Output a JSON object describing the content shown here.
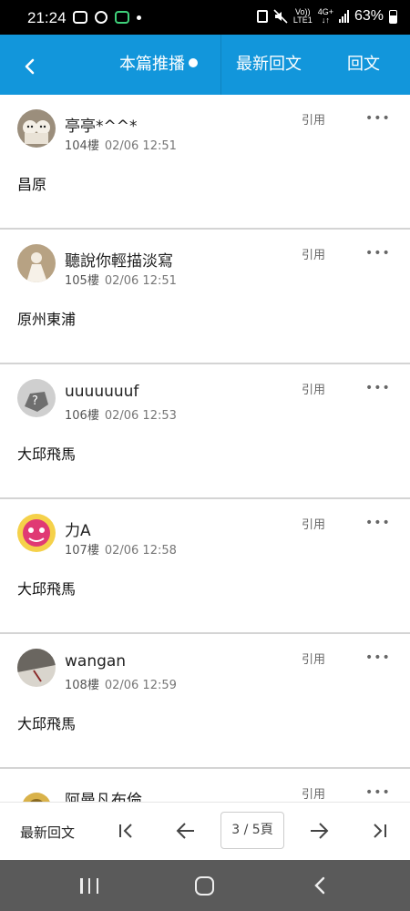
{
  "status_bar": {
    "time": "21:24",
    "network_top": "Vo))",
    "network_bottom": "LTE1",
    "net_type_top": "4G+",
    "net_type_bottom": "↓↑",
    "battery": "63%"
  },
  "header": {
    "tabs": [
      {
        "label": "本篇推播"
      },
      {
        "label": "最新回文"
      },
      {
        "label": "回文"
      }
    ]
  },
  "posts": [
    {
      "author": "亭亭*^^*",
      "floor": "104樓",
      "time": "02/06 12:51",
      "quote": "引用",
      "more": "•••",
      "content": "昌原",
      "avatar_colors": [
        "#e9e2d6",
        "#b9a892"
      ]
    },
    {
      "author": "聽說你輕描淡寫",
      "floor": "105樓",
      "time": "02/06 12:51",
      "quote": "引用",
      "more": "•••",
      "content": "原州東浦",
      "avatar_colors": [
        "#efe8dc",
        "#c8b89c"
      ]
    },
    {
      "author": "uuuuuuuf",
      "floor": "106樓",
      "time": "02/06 12:53",
      "quote": "引用",
      "more": "•••",
      "content": "大邱飛馬",
      "avatar_colors": [
        "#cfcfcf",
        "#7a7a7a"
      ]
    },
    {
      "author": "力A",
      "floor": "107樓",
      "time": "02/06 12:58",
      "quote": "引用",
      "more": "•••",
      "content": "大邱飛馬",
      "avatar_colors": [
        "#e0407a",
        "#f3c63a"
      ]
    },
    {
      "author": "wangan",
      "floor": "108樓",
      "time": "02/06 12:59",
      "quote": "引用",
      "more": "•••",
      "content": "大邱飛馬",
      "avatar_colors": [
        "#d8d4cc",
        "#5a5a55"
      ]
    },
    {
      "author": "阿曼凡布倫",
      "floor": "",
      "time": "",
      "quote": "引用",
      "more": "•••",
      "content": "",
      "avatar_colors": [
        "#d9b24a",
        "#8a6a20"
      ]
    }
  ],
  "bottom_bar": {
    "latest_label": "最新回文",
    "page_indicator": "3 / 5頁"
  },
  "colors": {
    "header_bg": "#1296db",
    "nav_bar_bg": "#5a5a5a"
  }
}
